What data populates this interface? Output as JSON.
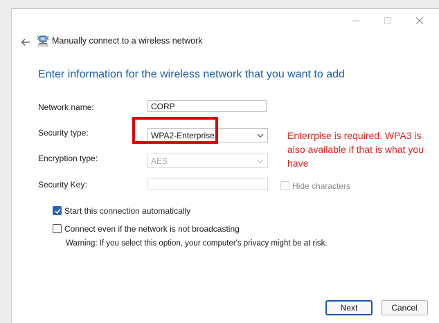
{
  "window": {
    "title": "Manually connect to a wireless network",
    "controls": [
      "minimize-icon",
      "maximize-icon",
      "close-icon"
    ]
  },
  "heading": "Enter information for the wireless network that you want to add",
  "form": {
    "network_name": {
      "label": "Network name:",
      "value": "CORP"
    },
    "security_type": {
      "label": "Security type:",
      "value": "WPA2-Enterprise"
    },
    "encryption_type": {
      "label": "Encryption type:",
      "value": "AES",
      "disabled": true
    },
    "security_key": {
      "label": "Security Key:",
      "value": "",
      "disabled": true
    },
    "hide_characters": {
      "label": "Hide characters",
      "checked": false,
      "disabled": true
    }
  },
  "options": {
    "start_auto": {
      "label": "Start this connection automatically",
      "checked": true
    },
    "connect_even": {
      "label": "Connect even if the network is not broadcasting",
      "checked": false
    },
    "warning": "Warning: If you select this option, your computer's privacy might be at risk."
  },
  "annotation": {
    "text": "Enterrpise is required. WPA3 is also available if that is what you have",
    "color": "#dd2222",
    "highlight_color": "#e00000"
  },
  "buttons": {
    "next": "Next",
    "cancel": "Cancel"
  },
  "colors": {
    "heading": "#1a5fa8",
    "accent": "#2b62b5",
    "default_button_border": "#1c55ab"
  }
}
